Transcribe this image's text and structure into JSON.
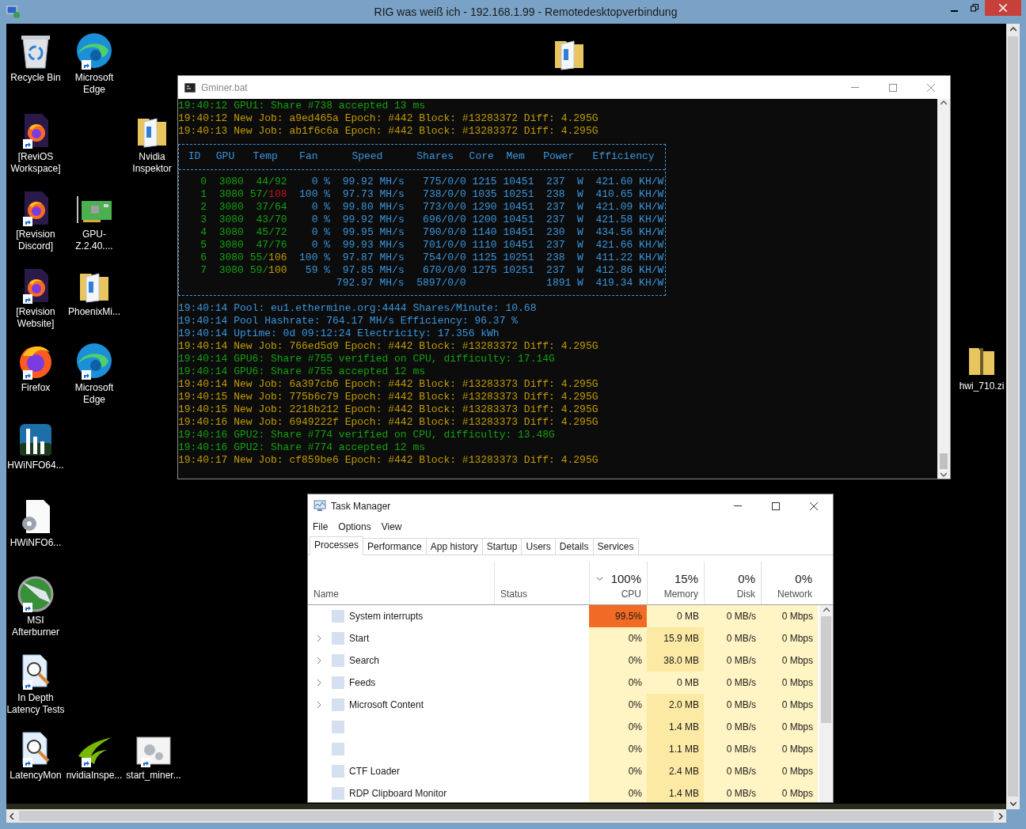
{
  "window": {
    "title": "RIG was weiß ich - 192.168.1.99 - Remotedesktopverbindung"
  },
  "desktop_icons": [
    {
      "kind": "recycle",
      "label": "Recycle Bin",
      "shortcut": false
    },
    {
      "kind": "edge",
      "label": "Microsoft Edge",
      "shortcut": true
    },
    {
      "kind": "firefox-doc",
      "label": "[ReviOS Workspace]",
      "shortcut": true
    },
    {
      "kind": "folder",
      "label": "Nvidia Inspektor",
      "shortcut": false
    },
    {
      "kind": "firefox-doc",
      "label": "[Revision Discord]",
      "shortcut": true
    },
    {
      "kind": "card",
      "label": "GPU-Z.2.40....",
      "shortcut": false
    },
    {
      "kind": "firefox-doc",
      "label": "[Revision Website]",
      "shortcut": true
    },
    {
      "kind": "folder",
      "label": "PhoenixMi...",
      "shortcut": false
    },
    {
      "kind": "firefox",
      "label": "Firefox",
      "shortcut": true
    },
    {
      "kind": "edge",
      "label": "Microsoft Edge",
      "shortcut": true
    },
    {
      "kind": "hwinfo",
      "label": "HWiNFO64...",
      "shortcut": false
    },
    {
      "kind": "settings-doc",
      "label": "HWiNFO6...",
      "shortcut": false
    },
    {
      "kind": "afterburner",
      "label": "MSI Afterburner",
      "shortcut": true
    },
    {
      "kind": "latency",
      "label": "In Depth Latency Tests",
      "shortcut": true
    },
    {
      "kind": "latency",
      "label": "LatencyMon",
      "shortcut": true
    },
    {
      "kind": "nvidia",
      "label": "nvidiaInspe...",
      "shortcut": true
    },
    {
      "kind": "gears",
      "label": "start_miner...",
      "shortcut": true
    },
    {
      "kind": "folder",
      "shortcut": false
    },
    {
      "kind": "zip",
      "label": "hwi_710.zi",
      "shortcut": false
    }
  ],
  "console": {
    "title": "Gminer.bat",
    "lines_before": [
      {
        "text": "19:40:12 GPU1: Share #738 accepted 13 ms",
        "color": "#13a10e"
      },
      {
        "text": "19:40:12 New Job: a9ed465a Epoch: #442 Block: #13283372 Diff: 4.295G",
        "color": "#c19c00"
      },
      {
        "text": "19:40:13 New Job: ab1f6c6a Epoch: #442 Block: #13283372 Diff: 4.295G",
        "color": "#c19c00"
      }
    ],
    "table": {
      "columns": [
        "ID",
        "GPU",
        "Temp",
        "Fan",
        "Speed",
        "Shares",
        "Core",
        "Mem",
        "Power",
        "Efficiency"
      ],
      "rows": [
        {
          "id": "0",
          "gpu": "3080",
          "temp": "44/",
          "limit": {
            "text": "92",
            "color": "#13a10e"
          },
          "fan": "0 %",
          "speed": "99.92 MH/s",
          "shares": "775/0/0",
          "core": "1215",
          "mem": "10451",
          "power": "237  W",
          "efficiency": "421.60 KH/W"
        },
        {
          "id": "1",
          "gpu": "3080",
          "temp": "57/",
          "limit": {
            "text": "108",
            "color": "#c50f1f"
          },
          "fan": "100 %",
          "speed": "97.73 MH/s",
          "shares": "738/0/0",
          "core": "1035",
          "mem": "10251",
          "power": "238  W",
          "efficiency": "410.65 KH/W"
        },
        {
          "id": "2",
          "gpu": "3080",
          "temp": "37/",
          "limit": {
            "text": "64",
            "color": "#13a10e"
          },
          "fan": "0 %",
          "speed": "99.80 MH/s",
          "shares": "773/0/0",
          "core": "1290",
          "mem": "10451",
          "power": "237  W",
          "efficiency": "421.09 KH/W"
        },
        {
          "id": "3",
          "gpu": "3080",
          "temp": "43/",
          "limit": {
            "text": "70",
            "color": "#13a10e"
          },
          "fan": "0 %",
          "speed": "99.92 MH/s",
          "shares": "696/0/0",
          "core": "1200",
          "mem": "10451",
          "power": "237  W",
          "efficiency": "421.58 KH/W"
        },
        {
          "id": "4",
          "gpu": "3080",
          "temp": "45/",
          "limit": {
            "text": "72",
            "color": "#13a10e"
          },
          "fan": "0 %",
          "speed": "99.95 MH/s",
          "shares": "790/0/0",
          "core": "1140",
          "mem": "10451",
          "power": "230  W",
          "efficiency": "434.56 KH/W"
        },
        {
          "id": "5",
          "gpu": "3080",
          "temp": "47/",
          "limit": {
            "text": "76",
            "color": "#13a10e"
          },
          "fan": "0 %",
          "speed": "99.93 MH/s",
          "shares": "701/0/0",
          "core": "1110",
          "mem": "10451",
          "power": "237  W",
          "efficiency": "421.66 KH/W"
        },
        {
          "id": "6",
          "gpu": "3080",
          "temp": "55/",
          "limit": {
            "text": "106",
            "color": "#c19c00"
          },
          "fan": "100 %",
          "speed": "97.87 MH/s",
          "shares": "754/0/0",
          "core": "1125",
          "mem": "10251",
          "power": "238  W",
          "efficiency": "411.22 KH/W"
        },
        {
          "id": "7",
          "gpu": "3080",
          "temp": "59/",
          "limit": {
            "text": "100",
            "color": "#c19c00"
          },
          "fan": "59 %",
          "speed": "97.85 MH/s",
          "shares": "670/0/0",
          "core": "1275",
          "mem": "10251",
          "power": "237  W",
          "efficiency": "412.86 KH/W"
        }
      ],
      "total": {
        "speed": "792.97 MH/s",
        "shares": "5897/0/0",
        "power": "1891 W",
        "efficiency": "419.34 KH/W"
      }
    },
    "lines_after": [
      {
        "text": "19:40:14 Pool: eu1.ethermine.org:4444 Shares/Minute: 10.68",
        "color": "#3a96dd"
      },
      {
        "text": "19:40:14 Pool Hashrate: 764.17 MH/s Efficiency: 96.37 %",
        "color": "#3a96dd"
      },
      {
        "text": "19:40:14 Uptime: 0d 09:12:24 Electricity: 17.356 kWh",
        "color": "#3a96dd"
      },
      {
        "text": "19:40:14 New Job: 766ed5d9 Epoch: #442 Block: #13283372 Diff: 4.295G",
        "color": "#c19c00"
      },
      {
        "text": "19:40:14 GPU6: Share #755 verified on CPU, difficulty: 17.14G",
        "color": "#13a10e"
      },
      {
        "text": "19:40:14 GPU6: Share #755 accepted 12 ms",
        "color": "#13a10e"
      },
      {
        "text": "19:40:14 New Job: 6a397cb6 Epoch: #442 Block: #13283373 Diff: 4.295G",
        "color": "#c19c00"
      },
      {
        "text": "19:40:15 New Job: 775b6c79 Epoch: #442 Block: #13283373 Diff: 4.295G",
        "color": "#c19c00"
      },
      {
        "text": "19:40:15 New Job: 2218b212 Epoch: #442 Block: #13283373 Diff: 4.295G",
        "color": "#c19c00"
      },
      {
        "text": "19:40:16 New Job: 6949222f Epoch: #442 Block: #13283373 Diff: 4.295G",
        "color": "#c19c00"
      },
      {
        "text": "19:40:16 GPU2: Share #774 verified on CPU, difficulty: 13.48G",
        "color": "#13a10e"
      },
      {
        "text": "19:40:16 GPU2: Share #774 accepted 12 ms",
        "color": "#13a10e"
      },
      {
        "text": "19:40:17 New Job: cf859be6 Epoch: #442 Block: #13283373 Diff: 4.295G",
        "color": "#c19c00"
      }
    ]
  },
  "task_manager": {
    "title": "Task Manager",
    "menu": [
      "File",
      "Options",
      "View"
    ],
    "tabs": [
      {
        "label": "Processes",
        "selected": true
      },
      {
        "label": "Performance",
        "selected": false
      },
      {
        "label": "App history",
        "selected": false
      },
      {
        "label": "Startup",
        "selected": false
      },
      {
        "label": "Users",
        "selected": false
      },
      {
        "label": "Details",
        "selected": false
      },
      {
        "label": "Services",
        "selected": false
      }
    ],
    "columns": [
      {
        "label": "Name"
      },
      {
        "label": "Status"
      },
      {
        "total": "100%",
        "label": "CPU",
        "sorted": true
      },
      {
        "total": "15%",
        "label": "Memory",
        "sorted": false
      },
      {
        "total": "0%",
        "label": "Disk",
        "sorted": false
      },
      {
        "total": "0%",
        "label": "Network",
        "sorted": false
      }
    ],
    "rows": [
      {
        "name": "System interrupts",
        "expandable": false,
        "cpu": {
          "text": "99.5%",
          "color": "#f26b25"
        },
        "memory": {
          "text": "0 MB",
          "color": "#fff4c4"
        },
        "disk": "0 MB/s",
        "network": "0 Mbps"
      },
      {
        "name": "Start",
        "expandable": true,
        "cpu": {
          "text": "0%",
          "color": "#fff4c4"
        },
        "memory": {
          "text": "15.9 MB",
          "color": "#fbe9a4"
        },
        "disk": "0 MB/s",
        "network": "0 Mbps"
      },
      {
        "name": "Search",
        "expandable": true,
        "cpu": {
          "text": "0%",
          "color": "#fff4c4"
        },
        "memory": {
          "text": "38.0 MB",
          "color": "#fbe9a4"
        },
        "disk": "0 MB/s",
        "network": "0 Mbps"
      },
      {
        "name": "Feeds",
        "expandable": true,
        "cpu": {
          "text": "0%",
          "color": "#fff4c4"
        },
        "memory": {
          "text": "0 MB",
          "color": "#fff4c4"
        },
        "disk": "0 MB/s",
        "network": "0 Mbps"
      },
      {
        "name": "Microsoft Content",
        "expandable": true,
        "cpu": {
          "text": "0%",
          "color": "#fff4c4"
        },
        "memory": {
          "text": "2.0 MB",
          "color": "#fbe9a4"
        },
        "disk": "0 MB/s",
        "network": "0 Mbps"
      },
      {
        "expandable": false,
        "cpu": {
          "text": "0%",
          "color": "#fff4c4"
        },
        "memory": {
          "text": "1.4 MB",
          "color": "#fbe9a4"
        },
        "disk": "0 MB/s",
        "network": "0 Mbps"
      },
      {
        "expandable": false,
        "cpu": {
          "text": "0%",
          "color": "#fff4c4"
        },
        "memory": {
          "text": "1.1 MB",
          "color": "#fbe9a4"
        },
        "disk": "0 MB/s",
        "network": "0 Mbps"
      },
      {
        "name": "CTF Loader",
        "expandable": false,
        "cpu": {
          "text": "0%",
          "color": "#fff4c4"
        },
        "memory": {
          "text": "2.4 MB",
          "color": "#fbe9a4"
        },
        "disk": "0 MB/s",
        "network": "0 Mbps"
      },
      {
        "name": "RDP Clipboard Monitor",
        "expandable": false,
        "cpu": {
          "text": "0%",
          "color": "#fff4c4"
        },
        "memory": {
          "text": "1.4 MB",
          "color": "#fbe9a4"
        },
        "disk": "0 MB/s",
        "network": "0 Mbps"
      }
    ]
  }
}
